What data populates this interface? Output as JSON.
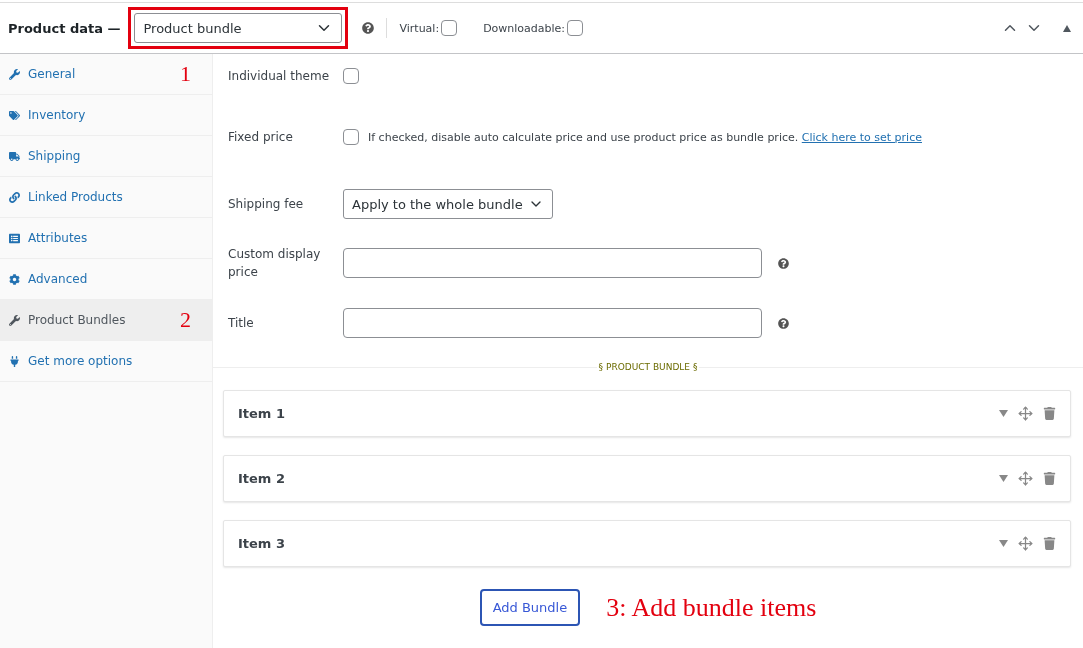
{
  "header": {
    "title": "Product data —",
    "product_type": "Product bundle",
    "highlighted": true,
    "checkboxes": [
      {
        "label": "Virtual:",
        "checked": false
      },
      {
        "label": "Downloadable:",
        "checked": false
      }
    ]
  },
  "sidebar": {
    "items": [
      {
        "label": "General",
        "selected": false,
        "annotation": "1"
      },
      {
        "label": "Inventory",
        "selected": false
      },
      {
        "label": "Shipping",
        "selected": false
      },
      {
        "label": "Linked Products",
        "selected": false
      },
      {
        "label": "Attributes",
        "selected": false
      },
      {
        "label": "Advanced",
        "selected": false
      },
      {
        "label": "Product Bundles",
        "selected": true,
        "annotation": "2"
      },
      {
        "label": "Get more options",
        "selected": false
      }
    ]
  },
  "fields": [
    {
      "kind": "checkbox",
      "label": "Individual theme",
      "checked": false
    },
    {
      "kind": "checkbox",
      "label": "Fixed price",
      "checked": false,
      "description": "If checked, disable auto calculate price and use product price as bundle price.",
      "link": "Click here to set price"
    },
    {
      "kind": "select",
      "label": "Shipping fee",
      "value": "Apply to the whole bundle"
    },
    {
      "kind": "text",
      "label": "Custom display price"
    },
    {
      "kind": "text",
      "label": "Title"
    }
  ],
  "section_title": "§ PRODUCT BUNDLE §",
  "bundle_items": [
    {
      "title": "Item 1"
    },
    {
      "title": "Item 2"
    },
    {
      "title": "Item 3"
    }
  ],
  "add_button": "Add Bundle",
  "annotation": "3: Add bundle items"
}
